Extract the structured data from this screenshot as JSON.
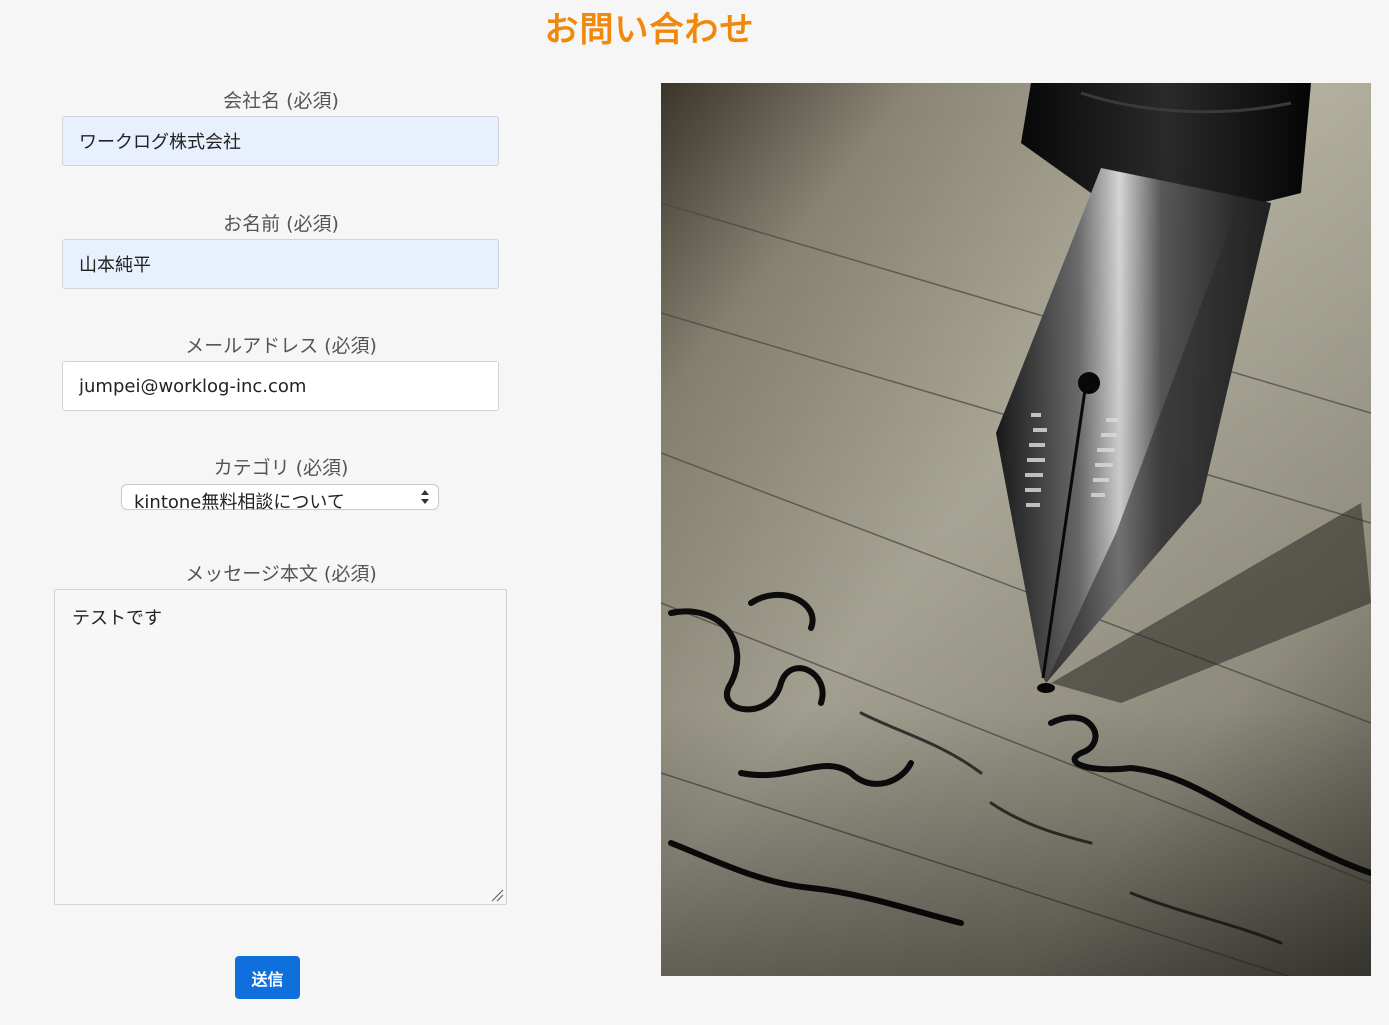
{
  "header": {
    "title": "お問い合わせ"
  },
  "form": {
    "company": {
      "label": "会社名 (必須)",
      "value": "ワークログ株式会社"
    },
    "name": {
      "label": "お名前 (必須)",
      "value": "山本純平"
    },
    "email": {
      "label": "メールアドレス (必須)",
      "value": "jumpei@worklog-inc.com"
    },
    "category": {
      "label": "カテゴリ (必須)",
      "selected": "kintone無料相談について"
    },
    "message": {
      "label": "メッセージ本文 (必須)",
      "value": "テストです"
    },
    "submit_label": "送信"
  },
  "colors": {
    "title": "#f0880c",
    "submit": "#0f6fdc",
    "autofill": "#e8f0fe"
  },
  "icons": {
    "select_arrows": "select-arrows-icon",
    "resize": "resize-handle-icon"
  }
}
